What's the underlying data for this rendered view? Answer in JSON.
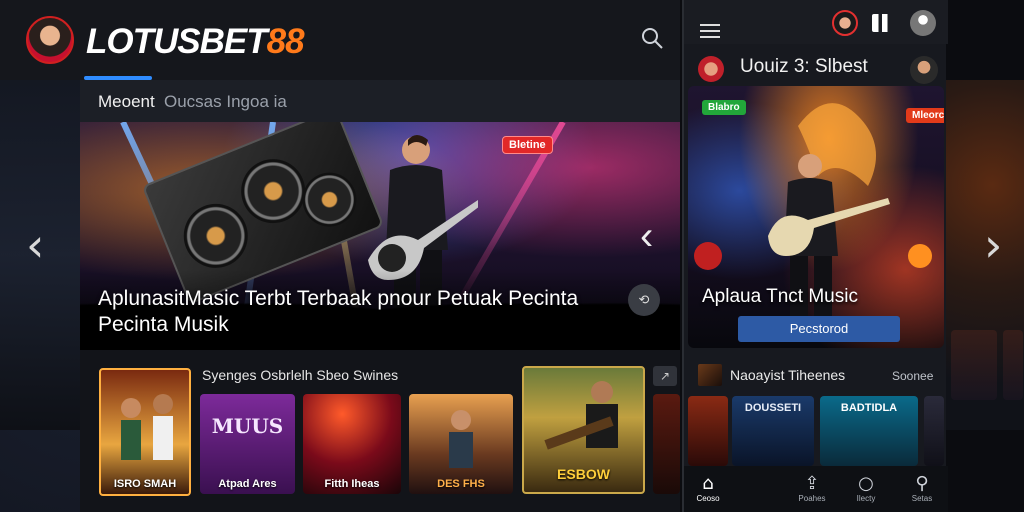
{
  "brand": {
    "part1": "LOTUSBET",
    "part2": "88",
    "accent": "#ff7a1a"
  },
  "tabs": [
    {
      "label": "Meoent"
    },
    {
      "label": "Oucsas Ingoa ia"
    }
  ],
  "hero": {
    "badge": "Bletine",
    "title": "AplunasitMasic Terbt Terbaak pnour Petuak Pecinta Pecinta Musik",
    "action_glyph": "⟲"
  },
  "strip": {
    "title": "Syenges Osbrlelh Sbeo Swines",
    "more_glyph": "↗",
    "cards": [
      {
        "caption": "ISRO SMAH"
      },
      {
        "caption": "Atpad Ares",
        "top": "MUUS"
      },
      {
        "caption": "Fitth Iheas"
      },
      {
        "caption": "DES FHS"
      },
      {
        "caption": "ESBOW"
      }
    ]
  },
  "mobile": {
    "header_title": "Uouiz 3: Slbest",
    "hero_badge_left": "Blabro",
    "hero_badge_right": "Mleorcre",
    "hero_title": "Aplaua Tnct Music",
    "hero_button": "Pecstorod",
    "strip_title": "Naoayist Tiheenes",
    "strip_more": "Soonee",
    "cards": [
      {
        "caption": ""
      },
      {
        "caption": "DOUSSETI"
      },
      {
        "caption": "BADTIDLA"
      }
    ],
    "bottom_nav": [
      {
        "label": "Ceoso",
        "icon": "home-icon",
        "glyph": "⌂",
        "active": true
      },
      {
        "label": "Poahes",
        "icon": "share-icon",
        "glyph": "⇪",
        "active": false
      },
      {
        "label": "Ilecty",
        "icon": "circle-icon",
        "glyph": "○",
        "active": false
      },
      {
        "label": "Setas",
        "icon": "search-icon",
        "glyph": "⚲",
        "active": false
      }
    ]
  },
  "colors": {
    "active_tab": "#2f8cff",
    "badge_red": "#e22828",
    "badge_green": "#22a63a",
    "button_blue": "#2d5aa5"
  }
}
